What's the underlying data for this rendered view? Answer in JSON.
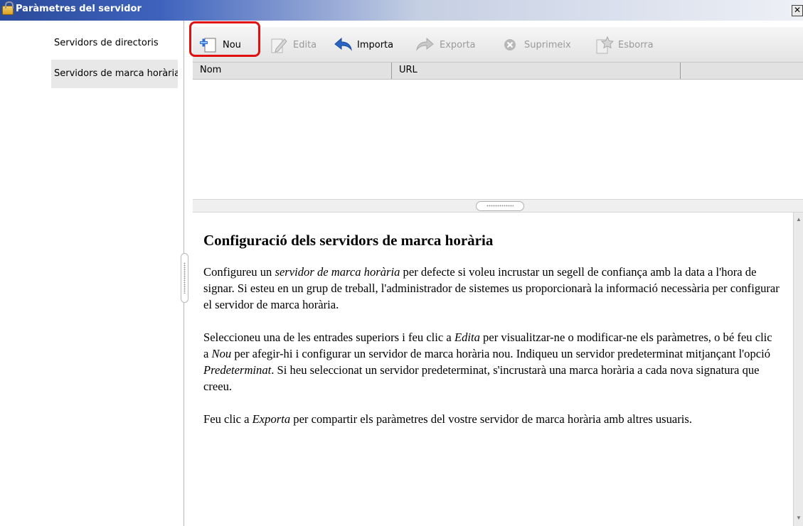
{
  "window": {
    "title": "Paràmetres del servidor",
    "close_glyph": "✕"
  },
  "sidebar": {
    "items": [
      {
        "label": "Servidors de directoris"
      },
      {
        "label": "Servidors de marca horària"
      }
    ]
  },
  "toolbar": {
    "new_label": "Nou",
    "edit_label": "Edita",
    "import_label": "Importa",
    "export_label": "Exporta",
    "delete_label": "Suprimeix",
    "clear_label": "Esborra"
  },
  "table": {
    "columns": [
      "Nom",
      "URL"
    ],
    "rows": []
  },
  "help": {
    "heading": "Configuració dels servidors de marca horària",
    "p1_a": "Configureu un ",
    "p1_em": "servidor de marca horària",
    "p1_b": " per defecte si voleu incrustar un segell de confiança amb la data a l'hora de signar. Si esteu en un grup de treball, l'administrador de sistemes us proporcionarà la informació necessària per configurar el servidor de marca horària.",
    "p2_a": "Seleccioneu una de les entrades superiors i feu clic a ",
    "p2_em1": "Edita",
    "p2_b": " per visualitzar-ne o modificar-ne els paràmetres, o bé feu clic a ",
    "p2_em2": "Nou",
    "p2_c": " per afegir-hi i configurar un servidor de marca horària nou. Indiqueu un servidor predeterminat mitjançant l'opció ",
    "p2_em3": "Predeterminat",
    "p2_d": ". Si heu seleccionat un servidor predeterminat, s'incrustarà una marca horària a cada nova signatura que creeu.",
    "p3_a": "Feu clic a ",
    "p3_em": "Exporta",
    "p3_b": " per compartir els paràmetres del vostre servidor de marca horària amb altres usuaris."
  },
  "colors": {
    "highlight": "#e01010",
    "titlebar": "#2a4a9a",
    "selected_bg": "#e8e8e8"
  },
  "icons": [
    "lock-icon",
    "new-icon",
    "edit-icon",
    "import-icon",
    "export-icon",
    "delete-icon",
    "clear-icon"
  ]
}
